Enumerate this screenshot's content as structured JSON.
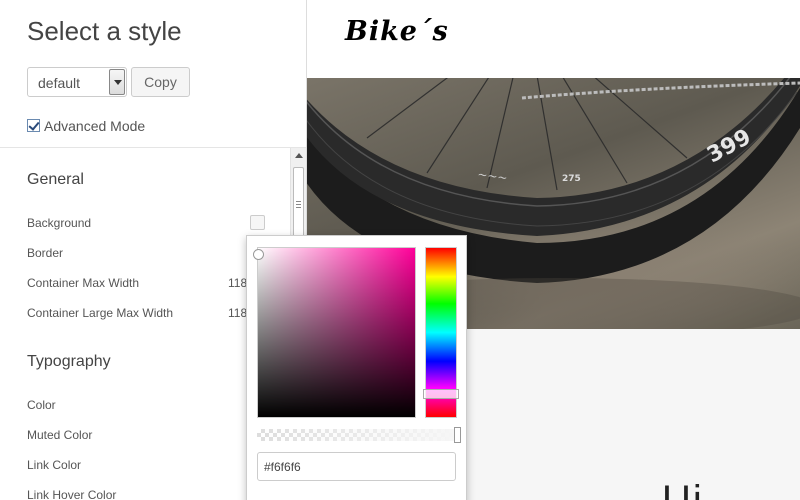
{
  "panel": {
    "title": "Select a style",
    "style_select": {
      "value": "default"
    },
    "copy_label": "Copy",
    "advanced_mode": {
      "label": "Advanced Mode",
      "checked": true
    }
  },
  "sections": {
    "general": {
      "heading": "General",
      "rows": [
        {
          "label": "Background",
          "type": "color"
        },
        {
          "label": "Border",
          "type": "color"
        },
        {
          "label": "Container Max Width",
          "value": "118"
        },
        {
          "label": "Container Large Max Width",
          "value": "118"
        }
      ]
    },
    "typography": {
      "heading": "Typography",
      "rows": [
        {
          "label": "Color"
        },
        {
          "label": "Muted Color"
        },
        {
          "label": "Link Color"
        },
        {
          "label": "Link Hover Color"
        }
      ]
    }
  },
  "preview": {
    "logo": "Bike´s",
    "hero_image": "bicycle-wheel-photo",
    "heading_fragment": "Ui"
  },
  "color_picker": {
    "hex_value": "#f6f6f6",
    "hue_color": "#ff0099",
    "hue_fraction": 0.88,
    "alpha_fraction": 1.0
  }
}
